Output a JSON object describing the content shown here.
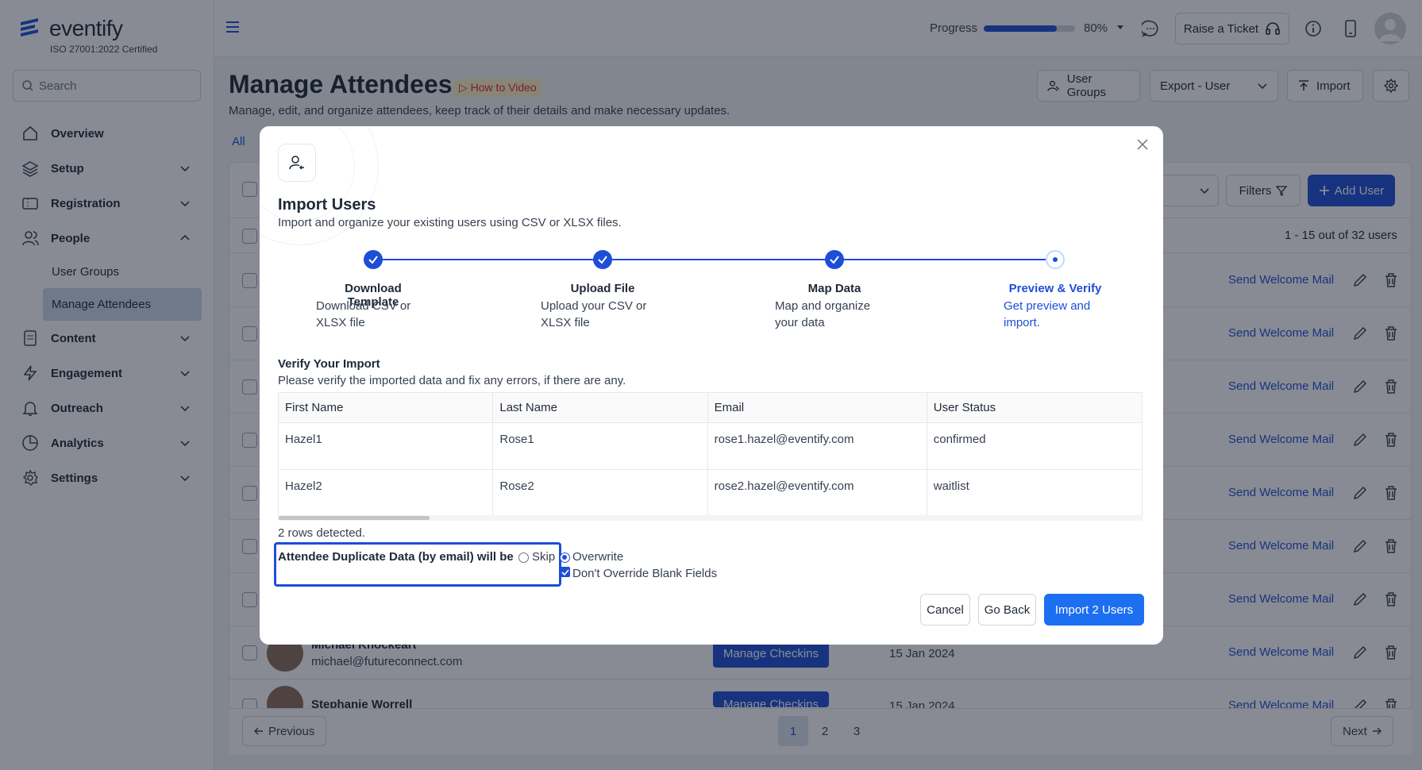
{
  "app": {
    "name": "eventify",
    "certification": "ISO 27001:2022 Certified",
    "search_placeholder": "Search"
  },
  "sidebar": {
    "items": [
      {
        "label": "Overview",
        "icon": "home-icon"
      },
      {
        "label": "Setup",
        "icon": "layers-icon"
      },
      {
        "label": "Registration",
        "icon": "ticket-icon"
      },
      {
        "label": "People",
        "icon": "users-icon"
      },
      {
        "label": "Content",
        "icon": "document-icon"
      },
      {
        "label": "Engagement",
        "icon": "lightning-icon"
      },
      {
        "label": "Outreach",
        "icon": "bell-icon"
      },
      {
        "label": "Analytics",
        "icon": "pie-chart-icon"
      },
      {
        "label": "Settings",
        "icon": "gear-icon"
      }
    ],
    "people_sub": [
      "User Groups",
      "Manage Attendees"
    ]
  },
  "topbar": {
    "progress_label": "Progress",
    "progress_value": 0.8,
    "progress_text": "80%",
    "ticket_label": "Raise a Ticket"
  },
  "page": {
    "title": "Manage Attendees",
    "howto": "How to Video",
    "subtitle": "Manage, edit, and organize attendees, keep track of their details and make necessary updates.",
    "user_groups_btn": "User Groups",
    "export_btn": "Export - User",
    "import_btn": "Import",
    "tab_all": "All",
    "filters_btn": "Filters",
    "add_user_btn": "Add User",
    "count_text": "1 - 15 out of 32 users",
    "welcome_label": "Send Welcome Mail",
    "checkins_label": "Manage Checkins",
    "rows": [
      {
        "name": "Michael Knockeart",
        "email": "michael@futureconnect.com",
        "date": "15 Jan 2024"
      },
      {
        "name": "Stephanie Worrell",
        "email": "",
        "date": "15 Jan 2024"
      }
    ]
  },
  "pagination": {
    "previous": "Previous",
    "next": "Next",
    "pages": [
      "1",
      "2",
      "3"
    ]
  },
  "modal": {
    "title": "Import Users",
    "subtitle": "Import and organize your existing users using CSV or XLSX files.",
    "steps": [
      {
        "title": "Download Template",
        "desc1": "Download CSV or",
        "desc2": "XLSX file"
      },
      {
        "title": "Upload File",
        "desc1": "Upload your CSV or",
        "desc2": "XLSX file"
      },
      {
        "title": "Map Data",
        "desc1": "Map and organize",
        "desc2": "your data"
      },
      {
        "title": "Preview & Verify",
        "desc1": "Get preview and",
        "desc2": "import."
      }
    ],
    "verify_title": "Verify Your Import",
    "verify_sub": "Please verify the imported data and fix any errors, if there are any.",
    "table": {
      "headers": [
        "First Name",
        "Last Name",
        "Email",
        "User Status"
      ],
      "rows": [
        [
          "Hazel1",
          "Rose1",
          "rose1.hazel@eventify.com",
          "confirmed"
        ],
        [
          "Hazel2",
          "Rose2",
          "rose2.hazel@eventify.com",
          "waitlist"
        ]
      ]
    },
    "rows_detected": "2 rows detected.",
    "duplicate_label": "Attendee Duplicate Data (by email) will be",
    "option_skip": "Skip",
    "option_overwrite": "Overwrite",
    "option_blank": "Don't Override Blank Fields",
    "cancel": "Cancel",
    "go_back": "Go Back",
    "import_btn": "Import 2 Users"
  },
  "colors": {
    "accent": "#1d4ed8",
    "primary_button": "#1d6ff2"
  }
}
